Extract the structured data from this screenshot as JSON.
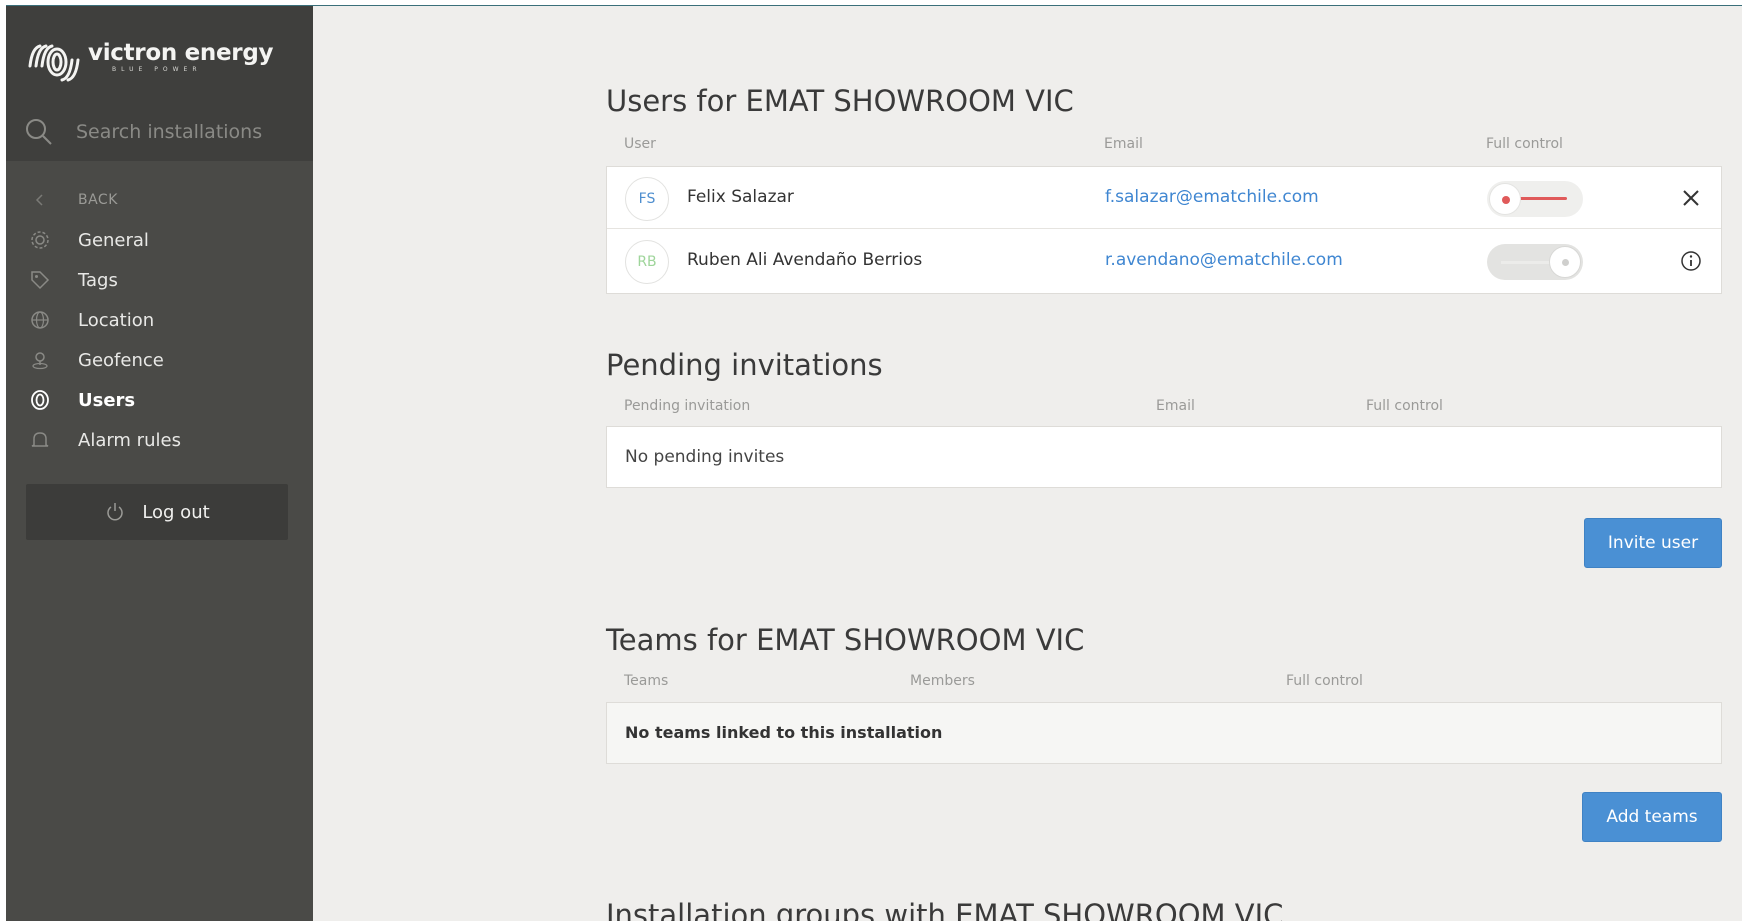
{
  "brand": {
    "name": "victron energy",
    "tagline": "BLUE POWER"
  },
  "search": {
    "placeholder": "Search installations"
  },
  "sidebar": {
    "back_label": "BACK",
    "items": [
      {
        "label": "General",
        "icon": "gear-icon"
      },
      {
        "label": "Tags",
        "icon": "tag-icon"
      },
      {
        "label": "Location",
        "icon": "globe-icon"
      },
      {
        "label": "Geofence",
        "icon": "geofence-icon"
      },
      {
        "label": "Users",
        "icon": "users-icon",
        "active": true
      },
      {
        "label": "Alarm rules",
        "icon": "bell-icon"
      }
    ],
    "logout_label": "Log out"
  },
  "users": {
    "title": "Users for EMAT SHOWROOM VIC",
    "columns": {
      "user": "User",
      "email": "Email",
      "full_control": "Full control"
    },
    "rows": [
      {
        "initials": "FS",
        "name": "Felix Salazar",
        "email": "f.salazar@ematchile.com",
        "full_control": true,
        "action_icon": "close-icon"
      },
      {
        "initials": "RB",
        "name": "Ruben Ali Avendaño Berrios",
        "email": "r.avendano@ematchile.com",
        "full_control": false,
        "action_icon": "info-icon"
      }
    ]
  },
  "pending": {
    "title": "Pending invitations",
    "columns": {
      "invitation": "Pending invitation",
      "email": "Email",
      "full_control": "Full control"
    },
    "empty_text": "No pending invites",
    "invite_button": "Invite user"
  },
  "teams": {
    "title": "Teams for EMAT SHOWROOM VIC",
    "columns": {
      "teams": "Teams",
      "members": "Members",
      "full_control": "Full control"
    },
    "empty_text": "No teams linked to this installation",
    "add_button": "Add teams"
  },
  "groups": {
    "title": "Installation groups with EMAT SHOWROOM VIC"
  },
  "colors": {
    "sidebar": "#4a4a47",
    "accent": "#4a90d4",
    "link": "#3f86d1",
    "toggle_on": "#e05a5a",
    "background": "#efeeec"
  }
}
